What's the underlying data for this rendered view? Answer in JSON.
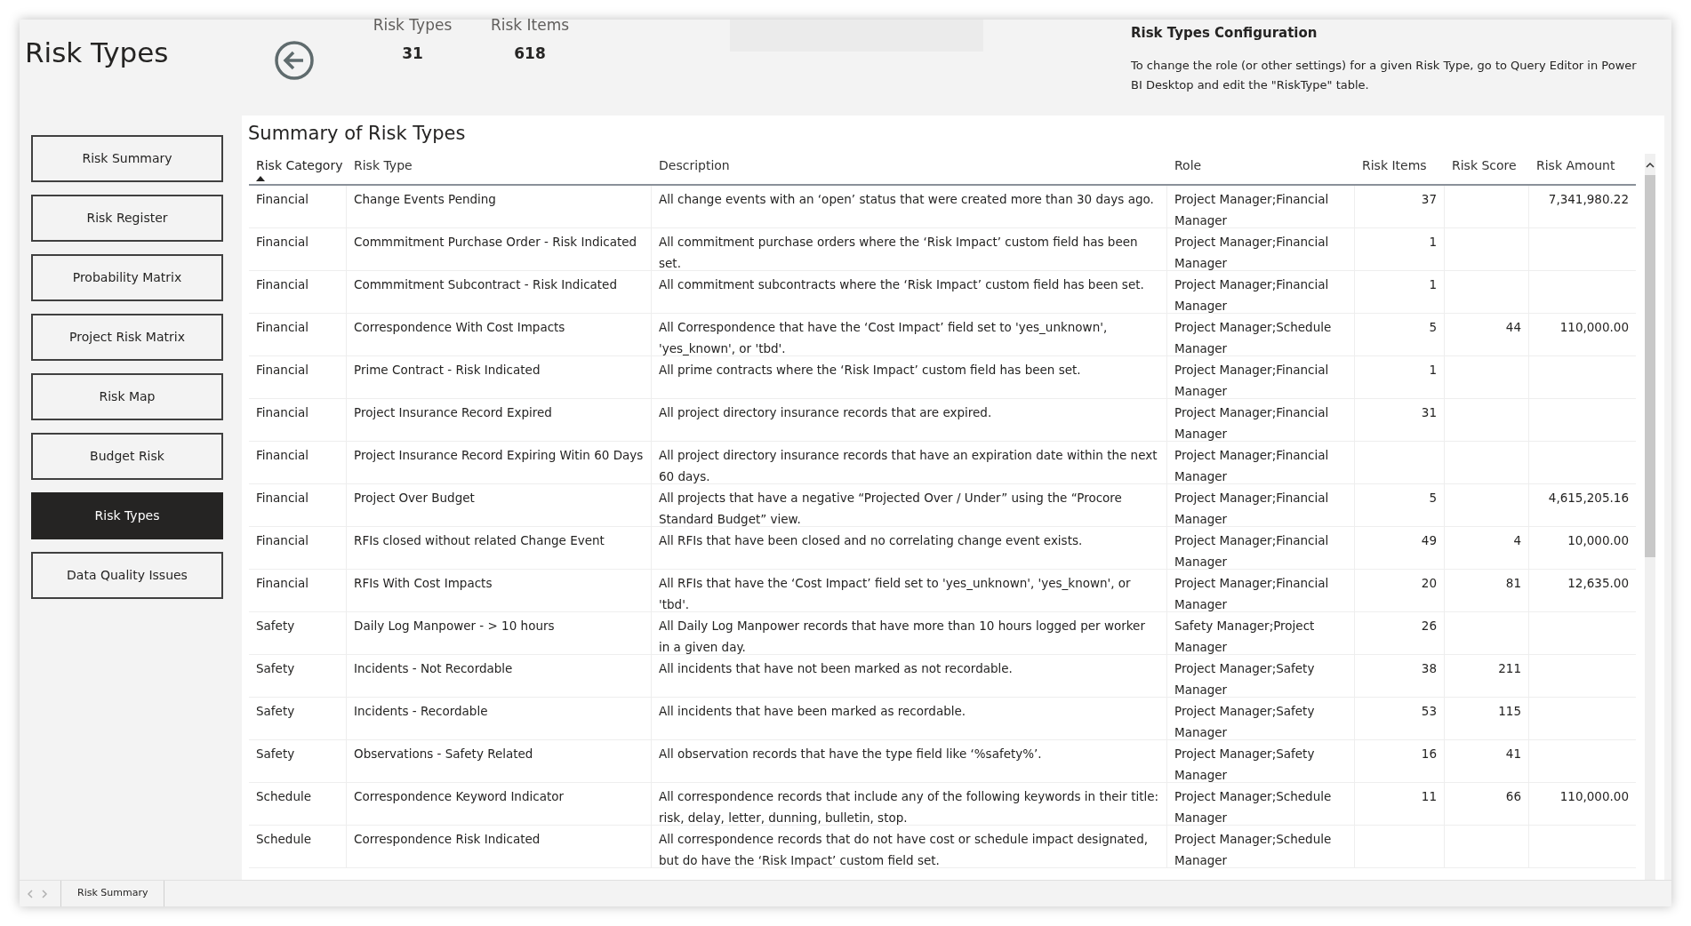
{
  "page_title": "Risk Types",
  "kpis": [
    {
      "label": "Risk Types",
      "value": "31"
    },
    {
      "label": "Risk Items",
      "value": "618"
    }
  ],
  "config": {
    "title": "Risk Types Configuration",
    "text": "To change the role (or other settings) for a given Risk Type, go to Query Editor in Power BI Desktop and edit the \"RiskType\" table."
  },
  "nav": [
    {
      "label": "Risk Summary",
      "selected": false
    },
    {
      "label": "Risk Register",
      "selected": false
    },
    {
      "label": "Probability Matrix",
      "selected": false
    },
    {
      "label": "Project Risk Matrix",
      "selected": false
    },
    {
      "label": "Risk Map",
      "selected": false
    },
    {
      "label": "Budget Risk",
      "selected": false
    },
    {
      "label": "Risk Types",
      "selected": true
    },
    {
      "label": "Data Quality Issues",
      "selected": false
    }
  ],
  "table": {
    "title": "Summary of Risk Types",
    "columns": [
      {
        "label": "Risk Category",
        "sorted": true,
        "kind": "text"
      },
      {
        "label": "Risk Type",
        "sorted": false,
        "kind": "text"
      },
      {
        "label": "Description",
        "sorted": false,
        "kind": "text"
      },
      {
        "label": "Role",
        "sorted": false,
        "kind": "text"
      },
      {
        "label": "Risk Items",
        "sorted": false,
        "kind": "number"
      },
      {
        "label": "Risk Score",
        "sorted": false,
        "kind": "number"
      },
      {
        "label": "Risk Amount",
        "sorted": false,
        "kind": "number"
      }
    ],
    "rows": [
      [
        "Financial",
        "Change Events Pending",
        "All change events with an ‘open’ status that were created more than 30 days ago.",
        "Project Manager;Financial Manager",
        "37",
        null,
        "7,341,980.22"
      ],
      [
        "Financial",
        "Commmitment Purchase Order - Risk Indicated",
        "All commitment purchase orders where the ‘Risk Impact’ custom field has been set.",
        "Project Manager;Financial Manager",
        "1",
        null,
        null
      ],
      [
        "Financial",
        "Commmitment Subcontract - Risk Indicated",
        "All commitment subcontracts where the ‘Risk Impact’ custom field has been set.",
        "Project Manager;Financial Manager",
        "1",
        null,
        null
      ],
      [
        "Financial",
        "Correspondence With Cost Impacts",
        "All Correspondence that have the ‘Cost Impact’ field set to 'yes_unknown', 'yes_known', or 'tbd'.",
        "Project Manager;Schedule Manager",
        "5",
        "44",
        "110,000.00"
      ],
      [
        "Financial",
        "Prime Contract - Risk Indicated",
        "All prime contracts where the ‘Risk Impact’ custom field has been set.",
        "Project Manager;Financial Manager",
        "1",
        null,
        null
      ],
      [
        "Financial",
        "Project Insurance Record Expired",
        "All project directory insurance records that are expired.",
        "Project Manager;Financial Manager",
        "31",
        null,
        null
      ],
      [
        "Financial",
        "Project Insurance Record Expiring Witin 60 Days",
        "All project directory insurance records that have an expiration date within the next 60 days.",
        "Project Manager;Financial Manager",
        null,
        null,
        null
      ],
      [
        "Financial",
        "Project Over Budget",
        "All projects that have a negative “Projected Over / Under” using the “Procore Standard Budget” view.",
        "Project Manager;Financial Manager",
        "5",
        null,
        "4,615,205.16"
      ],
      [
        "Financial",
        "RFIs closed without related Change Event",
        "All RFIs that have been closed and no correlating change event exists.",
        "Project Manager;Financial Manager",
        "49",
        "4",
        "10,000.00"
      ],
      [
        "Financial",
        "RFIs With Cost Impacts",
        "All RFIs that have the ‘Cost Impact’ field set to 'yes_unknown', 'yes_known', or 'tbd'.",
        "Project Manager;Financial Manager",
        "20",
        "81",
        "12,635.00"
      ],
      [
        "Safety",
        "Daily Log Manpower - > 10 hours",
        "All Daily Log Manpower records that have more than 10 hours logged per worker in a given day.",
        "Safety Manager;Project Manager",
        "26",
        null,
        null
      ],
      [
        "Safety",
        "Incidents - Not Recordable",
        "All incidents that have not been marked as not recordable.",
        "Project Manager;Safety Manager",
        "38",
        "211",
        null
      ],
      [
        "Safety",
        "Incidents - Recordable",
        "All incidents that have been marked as recordable.",
        "Project Manager;Safety Manager",
        "53",
        "115",
        null
      ],
      [
        "Safety",
        "Observations - Safety Related",
        "All observation records that have the type field like ‘%safety%’.",
        "Project Manager;Safety Manager",
        "16",
        "41",
        null
      ],
      [
        "Schedule",
        "Correspondence Keyword Indicator",
        "All correspondence records that include any of the following keywords in their title: risk, delay, letter, dunning, bulletin, stop.",
        "Project Manager;Schedule Manager",
        "11",
        "66",
        "110,000.00"
      ],
      [
        "Schedule",
        "Correspondence Risk Indicated",
        "All correspondence records that do not have cost or schedule impact designated, but do have the ‘Risk Impact’ custom field set.",
        "Project Manager;Schedule Manager",
        null,
        null,
        null
      ]
    ]
  },
  "page_tabs": [
    {
      "label": "Risk Summary",
      "selected": false
    }
  ]
}
